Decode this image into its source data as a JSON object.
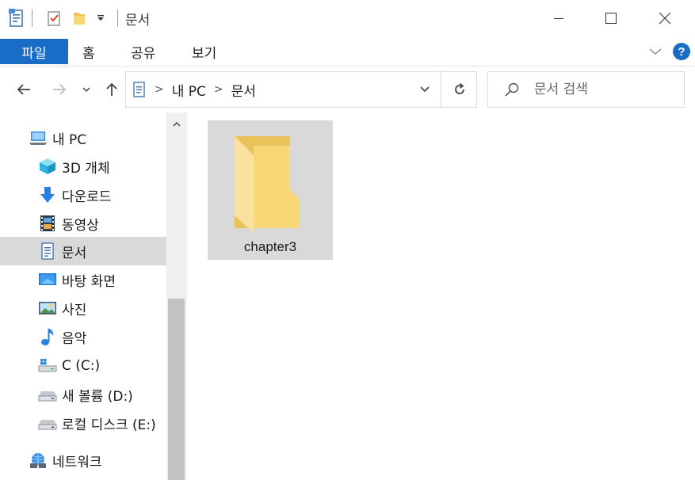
{
  "window": {
    "title": "문서"
  },
  "ribbon": {
    "tabs": [
      "파일",
      "홈",
      "공유",
      "보기"
    ]
  },
  "address": {
    "crumbs": [
      "내 PC",
      "문서"
    ]
  },
  "search": {
    "placeholder": "문서 검색"
  },
  "sidebar": {
    "items": [
      {
        "label": "내 PC",
        "icon": "computer-icon"
      },
      {
        "label": "3D 개체",
        "icon": "cube-3d-icon"
      },
      {
        "label": "다운로드",
        "icon": "download-arrow-icon"
      },
      {
        "label": "동영상",
        "icon": "film-icon"
      },
      {
        "label": "문서",
        "icon": "document-icon",
        "selected": true
      },
      {
        "label": "바탕 화면",
        "icon": "desktop-icon"
      },
      {
        "label": "사진",
        "icon": "picture-icon"
      },
      {
        "label": "음악",
        "icon": "music-note-icon"
      },
      {
        "label": "C (C:)",
        "icon": "windows-drive-icon"
      },
      {
        "label": "새 볼륨 (D:)",
        "icon": "drive-icon"
      },
      {
        "label": "로컬 디스크 (E:)",
        "icon": "drive-icon"
      },
      {
        "label": "네트워크",
        "icon": "network-icon"
      }
    ]
  },
  "content": {
    "items": [
      {
        "name": "chapter3",
        "type": "folder",
        "selected": true
      }
    ]
  },
  "colors": {
    "accent": "#1a6dc6",
    "selection": "#d9d9d9",
    "folder": "#f8d775"
  }
}
